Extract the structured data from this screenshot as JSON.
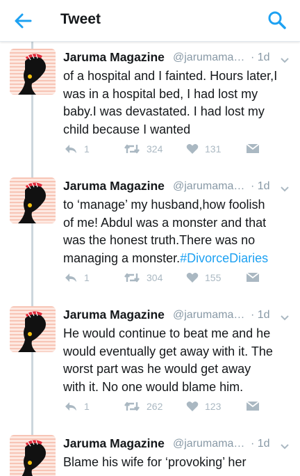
{
  "header": {
    "title": "Tweet",
    "back_icon": "arrow-left-icon",
    "search_icon": "search-icon",
    "accent": "#1da1f2"
  },
  "tweets": [
    {
      "name": "Jaruma Magazine",
      "handle": "@jarumama…",
      "time": "· 1d",
      "lines": [
        "of a hospital and I fainted. Hours later,I",
        "was in a hospital bed, I had lost my",
        "baby.I was devastated. I had lost my",
        "child because I wanted"
      ],
      "hashtag": "",
      "replies": "1",
      "retweets": "324",
      "likes": "131"
    },
    {
      "name": "Jaruma Magazine",
      "handle": "@jarumama…",
      "time": "· 1d",
      "lines": [
        "to ‘manage’ my husband,how foolish",
        "of me! Abdul was a monster and that",
        "was the honest truth.There was no",
        "managing a monster."
      ],
      "hashtag": "#DivorceDiaries",
      "replies": "1",
      "retweets": "304",
      "likes": "155"
    },
    {
      "name": "Jaruma Magazine",
      "handle": "@jarumama…",
      "time": "· 1d",
      "lines": [
        "He would continue to beat me and he",
        "would eventually get away with it. The",
        "worst part was he would get away",
        "with it. No one would blame him."
      ],
      "hashtag": "",
      "replies": "1",
      "retweets": "262",
      "likes": "123"
    },
    {
      "name": "Jaruma Magazine",
      "handle": "@jarumama…",
      "time": "· 1d",
      "lines": [
        "Blame  his wife for ‘provoking’ her"
      ],
      "hashtag": "",
      "replies": "",
      "retweets": "",
      "likes": ""
    }
  ]
}
